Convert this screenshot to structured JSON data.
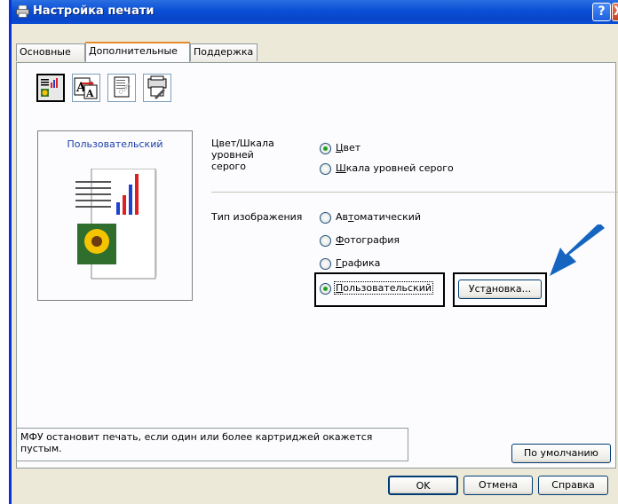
{
  "window": {
    "title": "Настройка печати",
    "help_label": "?",
    "close_label": "X"
  },
  "tabs": [
    "Основные",
    "Дополнительные",
    "Поддержка"
  ],
  "preview": {
    "caption": "Пользовательский"
  },
  "color_section": {
    "label": "Цвет/Шкала уровней серого",
    "options": [
      {
        "hot": "Ц",
        "rest": "вет",
        "selected": true
      },
      {
        "hot": "Ш",
        "rest": "кала уровней серого",
        "selected": false
      }
    ]
  },
  "image_type": {
    "label": "Тип изображения",
    "options": [
      {
        "pre": "Ав",
        "hot": "т",
        "rest": "оматический",
        "selected": false
      },
      {
        "pre": "",
        "hot": "Ф",
        "rest": "отография",
        "selected": false
      },
      {
        "pre": "",
        "hot": "Г",
        "rest": "рафика",
        "selected": false
      },
      {
        "pre": "",
        "hot": "П",
        "rest": "ользовательский",
        "selected": true
      }
    ],
    "settings_button": {
      "pre": "Уст",
      "hot": "а",
      "rest": "новка..."
    }
  },
  "status_text": "МФУ остановит печать, если один или более картриджей окажется пустым.",
  "default_button": "По умолчанию",
  "footer": {
    "ok": "OK",
    "cancel": "Отмена",
    "help": "Справка"
  },
  "colors": {
    "title_bar": "#0a4fd6",
    "accent_arrow": "#1565c0",
    "radio_dot": "#21a121",
    "tab_highlight": "#e68b2c"
  }
}
